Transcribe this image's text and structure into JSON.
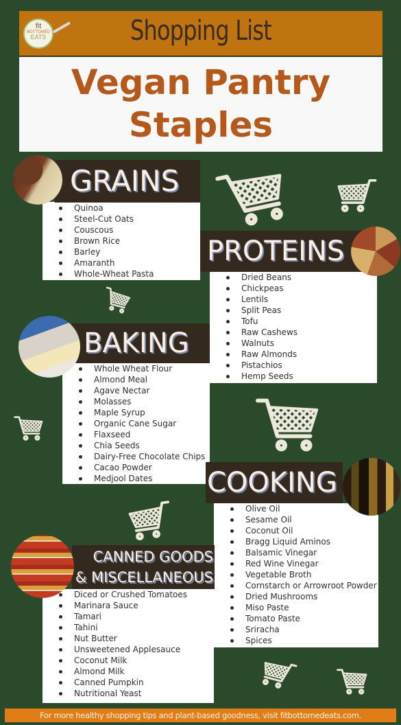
{
  "header": {
    "logo": {
      "line1": "fit",
      "line2": "BOTTOMED",
      "line3": "EATS"
    },
    "subtitle": "Shopping List",
    "title_line1": "Vegan Pantry",
    "title_line2": "Staples"
  },
  "colors": {
    "background": "#2b4a2b",
    "header_bar": "#bf7410",
    "title_text": "#b4581b",
    "section_bar": "#33291f",
    "footer_bar": "#e07d16"
  },
  "sections": {
    "grains": {
      "title": "GRAINS",
      "items": [
        "Quinoa",
        "Steel-Cut Oats",
        "Couscous",
        "Brown Rice",
        "Barley",
        "Amaranth",
        "Whole-Wheat Pasta"
      ]
    },
    "proteins": {
      "title": "PROTEINS",
      "items": [
        "Dried Beans",
        "Chickpeas",
        "Lentils",
        "Split Peas",
        "Tofu",
        "Raw Cashews",
        "Walnuts",
        "Raw Almonds",
        "Pistachios",
        "Hemp Seeds"
      ]
    },
    "baking": {
      "title": "BAKING",
      "items": [
        "Whole Wheat Flour",
        "Almond Meal",
        "Agave Nectar",
        "Molasses",
        "Maple Syrup",
        "Organic Cane Sugar",
        "Flaxseed",
        "Chia Seeds",
        "Dairy-Free Chocolate Chips",
        "Cacao Powder",
        "Medjool Dates"
      ]
    },
    "cooking": {
      "title": "COOKING",
      "items": [
        "Olive Oil",
        "Sesame Oil",
        "Coconut Oil",
        "Bragg Liquid Aminos",
        "Balsamic Vinegar",
        "Red Wine Vinegar",
        "Vegetable Broth",
        "Cornstarch or Arrowroot Powder",
        "Dried Mushrooms",
        "Miso Paste",
        "Tomato Paste",
        "Sriracha",
        "Spices"
      ]
    },
    "canned": {
      "title_line1": "CANNED GOODS",
      "title_line2": "& MISCELLANEOUS",
      "items": [
        "Diced or Crushed Tomatoes",
        "Marinara Sauce",
        "Tamari",
        "Tahini",
        "Nut Butter",
        "Unsweetened Applesauce",
        "Coconut Milk",
        "Almond Milk",
        "Canned Pumpkin",
        "Nutritional Yeast"
      ]
    }
  },
  "decorations": {
    "cart_icon": "shopping-cart-icon"
  },
  "footer": {
    "text": "For more healthy shopping tips and plant-based goodness, visit fitbottomedeats.com."
  }
}
